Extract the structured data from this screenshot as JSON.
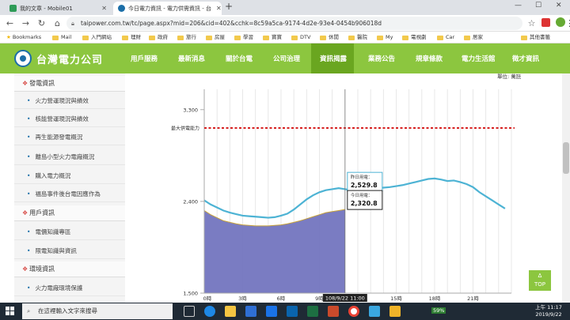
{
  "browser": {
    "tabs": [
      {
        "title": "我的文章 - Mobile01",
        "active": false
      },
      {
        "title": "今日電力資訊 - 電力供需資訊 - 台",
        "active": true
      }
    ],
    "new_tab": "+",
    "url": "taipower.com.tw/tc/page.aspx?mid=206&cid=402&cchk=8c59a5ca-9174-4d2e-93e4-0454b906018d",
    "bookmarks": [
      "Bookmarks",
      "Mail",
      "入門網站",
      "理財",
      "政府",
      "旅行",
      "房屋",
      "學習",
      "寶寶",
      "DTV",
      "休閒",
      "醫院",
      "My",
      "電視劇",
      "Car",
      "居家"
    ],
    "other_bookmarks": "其他書籤"
  },
  "site": {
    "logo": "台灣電力公司",
    "nav": [
      "用戶服務",
      "最新消息",
      "關於台電",
      "公司治理",
      "資訊揭露",
      "業務公告",
      "規章條款",
      "電力生活館",
      "徵才資訊"
    ],
    "active_nav": "資訊揭露"
  },
  "sidebar": {
    "sections": [
      {
        "title": "發電資訊",
        "items": [
          "火力營運現況與績效",
          "核能營運現況與績效",
          "再生能源發電概況",
          "離島小型火力電廠概況",
          "購入電力概況",
          "福島事件後台電因應作為"
        ]
      },
      {
        "title": "用戶資訊",
        "items": [
          "電價知識專區",
          "限電知識與資訊"
        ]
      },
      {
        "title": "環境資訊",
        "items": [
          "火力電廠環境保護"
        ]
      }
    ]
  },
  "chart_data": {
    "type": "area",
    "unit_label": "單位: 萬瓩",
    "ylim": [
      1500,
      3500
    ],
    "yticks": [
      1500,
      2400,
      3300
    ],
    "ytick_labels": [
      "1,500",
      "2,400",
      "3,300"
    ],
    "x_tick_labels": [
      "0時",
      "3時",
      "6時",
      "9時",
      "12時",
      "15時",
      "18時",
      "21時"
    ],
    "max_supply_label": "最大供電能力",
    "max_supply_value": 3120,
    "series": [
      {
        "name": "昨日用電",
        "color": "#4db3d4",
        "x": [
          0,
          0.5,
          1,
          1.5,
          2,
          2.5,
          3,
          3.5,
          4,
          4.5,
          5,
          5.5,
          6,
          6.5,
          7,
          7.5,
          8,
          8.5,
          9,
          9.5,
          10,
          10.5,
          11,
          11.5,
          12,
          12.5,
          13,
          13.5,
          14,
          14.5,
          15,
          15.5,
          16,
          16.5,
          17,
          17.5,
          18,
          18.5,
          19,
          19.5,
          20,
          20.5,
          21,
          21.5,
          22,
          22.5,
          23,
          23.5
        ],
        "values": [
          2410,
          2370,
          2340,
          2310,
          2290,
          2275,
          2260,
          2255,
          2250,
          2245,
          2240,
          2245,
          2260,
          2280,
          2320,
          2370,
          2420,
          2460,
          2490,
          2510,
          2520,
          2529.8,
          2520,
          2510,
          2505,
          2515,
          2525,
          2530,
          2535,
          2540,
          2550,
          2560,
          2575,
          2590,
          2605,
          2620,
          2625,
          2615,
          2600,
          2605,
          2590,
          2570,
          2540,
          2490,
          2450,
          2410,
          2370,
          2330
        ]
      },
      {
        "name": "今日用電",
        "color": "#7375bf",
        "x": [
          0,
          0.5,
          1,
          1.5,
          2,
          2.5,
          3,
          3.5,
          4,
          4.5,
          5,
          5.5,
          6,
          6.5,
          7,
          7.5,
          8,
          8.5,
          9,
          9.5,
          10,
          10.5,
          11
        ],
        "values": [
          2310,
          2270,
          2240,
          2210,
          2195,
          2180,
          2170,
          2165,
          2160,
          2160,
          2160,
          2165,
          2170,
          2180,
          2195,
          2210,
          2230,
          2250,
          2270,
          2290,
          2300,
          2310,
          2320.8
        ]
      }
    ],
    "cursor_label": "108/9/22 11:00",
    "tooltips": [
      {
        "title": "昨日用電：",
        "value": "2,529.8"
      },
      {
        "title": "今日用電：",
        "value": "2,320.8"
      }
    ],
    "grid": "vertical"
  },
  "top_button": {
    "arrow": "∆",
    "label": "TOP"
  },
  "taskbar": {
    "search_placeholder": "在這裡輸入文字來搜尋",
    "battery": "59%",
    "time": "上午 11:17",
    "date": "2019/9/22"
  }
}
